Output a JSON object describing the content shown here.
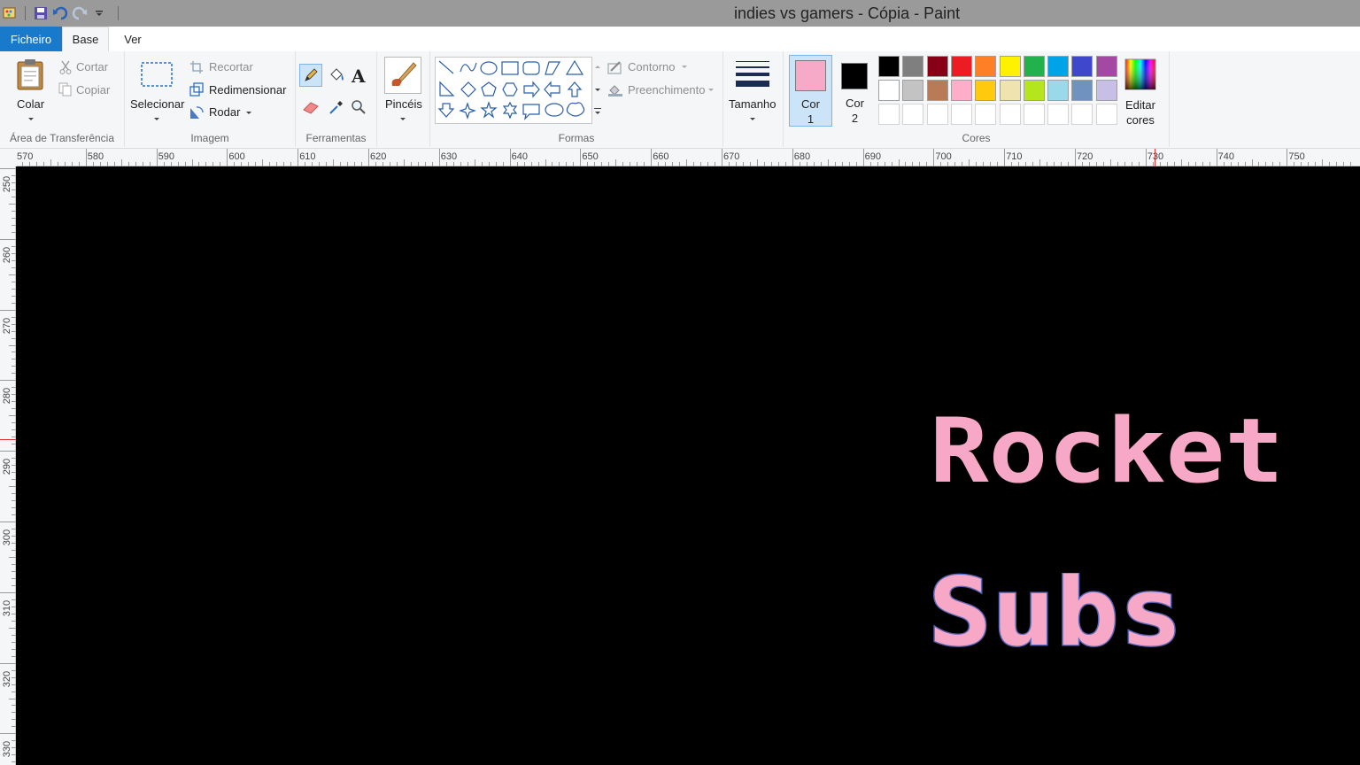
{
  "window": {
    "title": "indies vs gamers - Cópia - Paint"
  },
  "menu": {
    "file": "Ficheiro",
    "tabs": [
      "Base",
      "Ver"
    ]
  },
  "clipboard": {
    "paste": "Colar",
    "cut": "Cortar",
    "copy": "Copiar",
    "label": "Área de Transferência"
  },
  "image": {
    "select": "Selecionar",
    "crop": "Recortar",
    "resize": "Redimensionar",
    "rotate": "Rodar",
    "label": "Imagem"
  },
  "tools": {
    "label": "Ferramentas"
  },
  "brushes": {
    "label": "Pincéis"
  },
  "shapes": {
    "outline": "Contorno",
    "fill": "Preenchimento",
    "label": "Formas"
  },
  "size": {
    "label": "Tamanho"
  },
  "colors": {
    "color1": "Cor 1",
    "color2": "Cor 2",
    "edit": "Editar cores",
    "label": "Cores",
    "color1_value": "#f7aac8",
    "color2_value": "#000000",
    "palette_row1": [
      "#000000",
      "#7f7f7f",
      "#880015",
      "#ed1c24",
      "#ff7f27",
      "#fff200",
      "#22b14c",
      "#00a2e8",
      "#3f48cc",
      "#a349a4"
    ],
    "palette_row2": [
      "#ffffff",
      "#c3c3c3",
      "#b97a57",
      "#ffaec9",
      "#ffc90e",
      "#efe4b0",
      "#b5e61d",
      "#99d9ea",
      "#7092be",
      "#c8bfe7"
    ]
  },
  "ruler": {
    "h": [
      "570",
      "580",
      "590",
      "600",
      "610",
      "620",
      "630",
      "640",
      "650",
      "660",
      "670",
      "680",
      "690",
      "700",
      "710",
      "720",
      "730",
      "740",
      "750"
    ],
    "v": [
      "250",
      "260",
      "270",
      "280",
      "290",
      "300",
      "310",
      "320",
      "330"
    ]
  },
  "canvas": {
    "line1": "Rocket",
    "line2": "Subs"
  }
}
